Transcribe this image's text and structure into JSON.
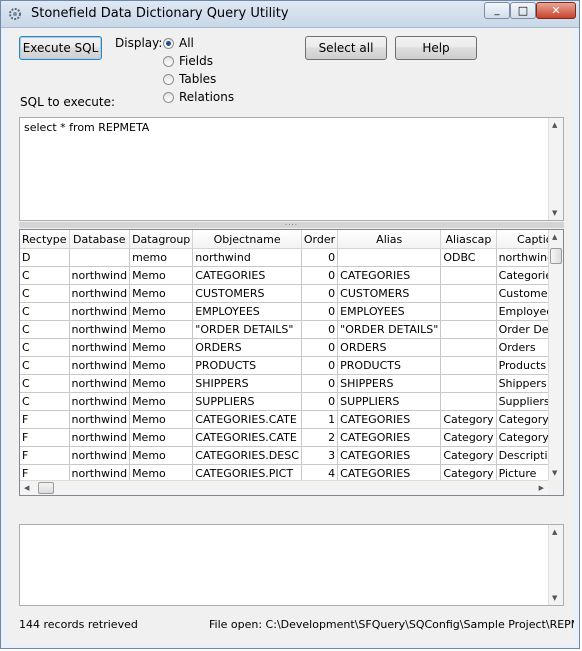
{
  "window": {
    "title": "Stonefield Data Dictionary Query Utility",
    "min_glyph": "_",
    "max_glyph": "□",
    "close_glyph": "✕"
  },
  "toolbar": {
    "execute_label": "Execute SQL",
    "display_label": "Display:",
    "select_all_label": "Select all",
    "help_label": "Help"
  },
  "display_options": [
    {
      "label": "All",
      "selected": true
    },
    {
      "label": "Fields",
      "selected": false
    },
    {
      "label": "Tables",
      "selected": false
    },
    {
      "label": "Relations",
      "selected": false
    }
  ],
  "sql": {
    "label": "SQL to execute:",
    "value": "select * from REPMETA"
  },
  "grid": {
    "columns": [
      "Rectype",
      "Database",
      "Datagroup",
      "Objectname",
      "Order",
      "Alias",
      "Aliascap",
      "Caption"
    ],
    "rows": [
      [
        "D",
        "",
        "memo",
        "northwind",
        "0",
        "",
        "ODBC",
        "northwind"
      ],
      [
        "C",
        "northwind",
        "Memo",
        "CATEGORIES",
        "0",
        "CATEGORIES",
        "",
        "Categories"
      ],
      [
        "C",
        "northwind",
        "Memo",
        "CUSTOMERS",
        "0",
        "CUSTOMERS",
        "",
        "Customers"
      ],
      [
        "C",
        "northwind",
        "Memo",
        "EMPLOYEES",
        "0",
        "EMPLOYEES",
        "",
        "Employees"
      ],
      [
        "C",
        "northwind",
        "Memo",
        "\"ORDER DETAILS\"",
        "0",
        "\"ORDER DETAILS\"",
        "",
        "Order Details"
      ],
      [
        "C",
        "northwind",
        "Memo",
        "ORDERS",
        "0",
        "ORDERS",
        "",
        "Orders"
      ],
      [
        "C",
        "northwind",
        "Memo",
        "PRODUCTS",
        "0",
        "PRODUCTS",
        "",
        "Products"
      ],
      [
        "C",
        "northwind",
        "Memo",
        "SHIPPERS",
        "0",
        "SHIPPERS",
        "",
        "Shippers"
      ],
      [
        "C",
        "northwind",
        "Memo",
        "SUPPLIERS",
        "0",
        "SUPPLIERS",
        "",
        "Suppliers"
      ],
      [
        "F",
        "northwind",
        "Memo",
        "CATEGORIES.CATE",
        "1",
        "CATEGORIES",
        "Category",
        "Category ID"
      ],
      [
        "F",
        "northwind",
        "Memo",
        "CATEGORIES.CATE",
        "2",
        "CATEGORIES",
        "Category",
        "Category Nam"
      ],
      [
        "F",
        "northwind",
        "Memo",
        "CATEGORIES.DESC",
        "3",
        "CATEGORIES",
        "Category",
        "Description"
      ],
      [
        "F",
        "northwind",
        "Memo",
        "CATEGORIES.PICT",
        "4",
        "CATEGORIES",
        "Category",
        "Picture"
      ]
    ]
  },
  "output": {
    "value": ""
  },
  "status": {
    "records": "144 records retrieved",
    "file_open": "File open: C:\\Development\\SFQuery\\SQConfig\\Sample Project\\REPMETA"
  },
  "icons": {
    "app": "gear-icon",
    "scroll_up": "chevron-up-icon",
    "scroll_down": "chevron-down-icon",
    "scroll_left": "chevron-left-icon",
    "scroll_right": "chevron-right-icon"
  },
  "colors": {
    "titlebar": "#c9d7e8",
    "close_button": "#c8432c",
    "default_button_border": "#3c7fb1",
    "radio_selected": "#1f4f8e"
  }
}
